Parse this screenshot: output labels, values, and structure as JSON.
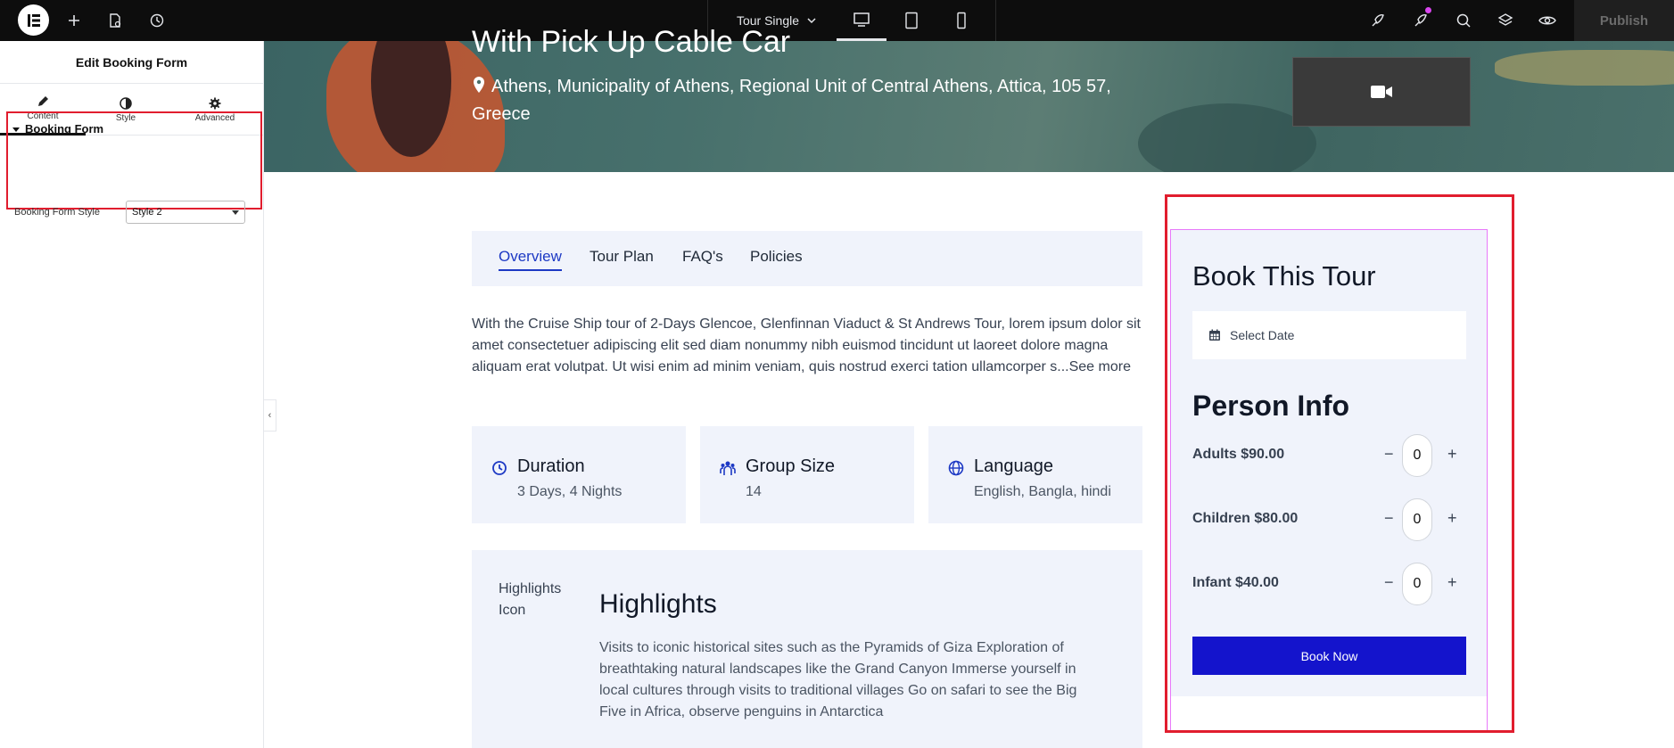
{
  "topbar": {
    "page_name": "Tour Single",
    "publish_label": "Publish"
  },
  "panel": {
    "title": "Edit Booking Form",
    "tabs": [
      {
        "label": "Content",
        "icon": "pencil-icon",
        "active": true
      },
      {
        "label": "Style",
        "icon": "contrast-icon",
        "active": false
      },
      {
        "label": "Advanced",
        "icon": "gear-icon",
        "active": false
      }
    ],
    "section_title": "Booking Form",
    "field_label": "Booking Form Style",
    "field_value": "Style 2"
  },
  "hero": {
    "title": "With Pick Up Cable Car",
    "address": "Athens, Municipality of Athens, Regional Unit of Central Athens, Attica, 105 57, Greece"
  },
  "tabs": [
    {
      "label": "Overview",
      "active": true
    },
    {
      "label": "Tour Plan",
      "active": false
    },
    {
      "label": "FAQ's",
      "active": false
    },
    {
      "label": "Policies",
      "active": false
    }
  ],
  "overview": {
    "text": "With the Cruise Ship tour of 2-Days Glencoe, Glenfinnan Viaduct & St Andrews Tour, lorem ipsum dolor sit amet consectetuer adipiscing elit sed diam nonummy nibh euismod tincidunt ut laoreet dolore magna aliquam erat volutpat. Ut wisi enim ad minim veniam, quis nostrud exerci tation ullamcorper s...",
    "see_more": "See more"
  },
  "info_cards": [
    {
      "title": "Duration",
      "value": "3 Days, 4 Nights",
      "icon": "history-icon"
    },
    {
      "title": "Group Size",
      "value": "14",
      "icon": "group-icon"
    },
    {
      "title": "Language",
      "value": "English, Bangla, hindi",
      "icon": "globe-icon"
    }
  ],
  "highlights": {
    "icon_label": "Highlights Icon",
    "title": "Highlights",
    "text": "Visits to iconic historical sites such as the Pyramids of Giza Exploration of breathtaking natural landscapes like the Grand Canyon Immerse yourself in local cultures through visits to traditional villages Go on safari to see the Big Five in Africa, observe penguins in Antarctica"
  },
  "booking": {
    "title": "Book This Tour",
    "date_placeholder": "Select Date",
    "person_title": "Person Info",
    "persons": [
      {
        "label": "Adults $90.00",
        "qty": "0"
      },
      {
        "label": "Children $80.00",
        "qty": "0"
      },
      {
        "label": "Infant $40.00",
        "qty": "0"
      }
    ],
    "minus": "−",
    "plus": "+",
    "button": "Book Now"
  },
  "colors": {
    "accent": "#1d39c4",
    "button": "#1414cc",
    "highlight_outline": "#e11d2e",
    "card_bg": "#f0f3fb"
  }
}
